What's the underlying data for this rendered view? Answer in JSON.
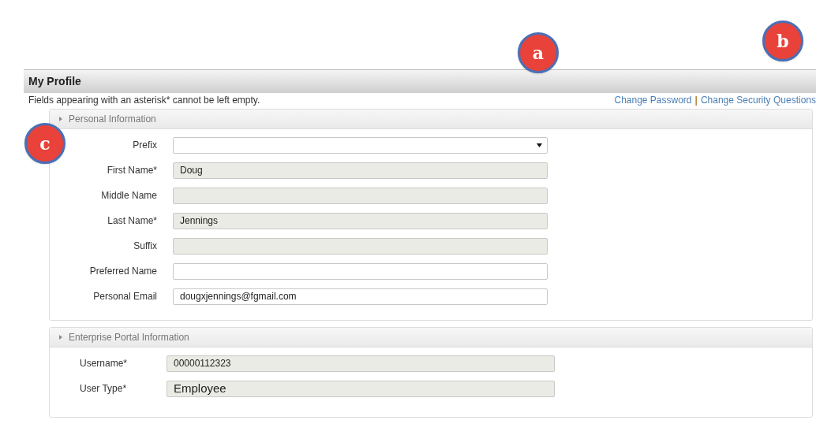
{
  "title": "My Profile",
  "note": "Fields appearing with an asterisk* cannot be left empty.",
  "links": [
    {
      "label": "Change Password"
    },
    {
      "label": "Change Security Questions"
    }
  ],
  "link_separator": "|",
  "sections": [
    {
      "title": "Personal Information",
      "labels_left": false,
      "fields": [
        {
          "label": "Prefix",
          "kind": "select",
          "disabled": false
        },
        {
          "label": "First Name*",
          "kind": "input",
          "disabled": true,
          "value": "Doug"
        },
        {
          "label": "Middle Name",
          "kind": "input",
          "disabled": true
        },
        {
          "label": "Last Name*",
          "kind": "input",
          "disabled": true,
          "value": "Jennings"
        },
        {
          "label": "Suffix",
          "kind": "input",
          "disabled": true
        },
        {
          "label": "Preferred Name",
          "kind": "input",
          "disabled": false
        },
        {
          "label": "Personal Email",
          "kind": "input",
          "disabled": false,
          "value": "dougxjennings@fgmail.com"
        }
      ]
    },
    {
      "title": "Enterprise Portal Information",
      "labels_left": true,
      "fields": [
        {
          "label": "Username*",
          "kind": "input",
          "disabled": true,
          "value": "00000112323"
        },
        {
          "label": "User Type*",
          "kind": "input",
          "disabled": true,
          "value": "Employee",
          "large": true
        }
      ]
    }
  ],
  "callouts": [
    {
      "label": "a"
    },
    {
      "label": "b"
    },
    {
      "label": "c"
    }
  ]
}
